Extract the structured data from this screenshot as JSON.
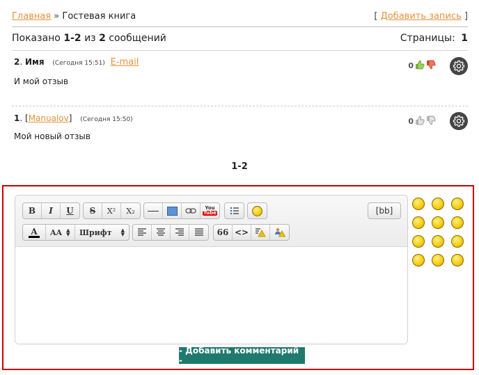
{
  "breadcrumb": {
    "home": "Главная",
    "separator": "»",
    "current": "Гостевая книга"
  },
  "add_record": {
    "open": "[",
    "label": "Добавить запись",
    "close": "]"
  },
  "summary": {
    "prefix": "Показано",
    "range": "1-2",
    "of": "из",
    "total": "2",
    "suffix": "сообщений",
    "pages_label": "Страницы:",
    "page": "1"
  },
  "entries": [
    {
      "number": "2",
      "dot": ".",
      "name": "Имя",
      "date": "(Сегодня 15:51)",
      "email_label": "E-mail",
      "text": "И мой отзыв",
      "rating": "0"
    },
    {
      "number": "1",
      "dot": ".",
      "name_open": "[",
      "name": "Manualov",
      "name_close": "]",
      "date": "(Сегодня 15:50)",
      "text": "Мой новый отзыв",
      "rating": "0"
    }
  ],
  "pager": "1-2",
  "editor": {
    "bold": "B",
    "italic": "I",
    "underline": "U",
    "strike": "S",
    "sup": "X²",
    "sub": "X₂",
    "font_size": "AA",
    "font": "Шрифт",
    "quote": "66",
    "code": "<>",
    "bb": "[bb]",
    "youtube_top": "You",
    "youtube_bottom": "Tube"
  },
  "submit_label": "- Добавить комментарий -",
  "colors": {
    "link": "#e8913a",
    "submit_bg": "#1e7a6d",
    "form_border": "#cc0000"
  }
}
